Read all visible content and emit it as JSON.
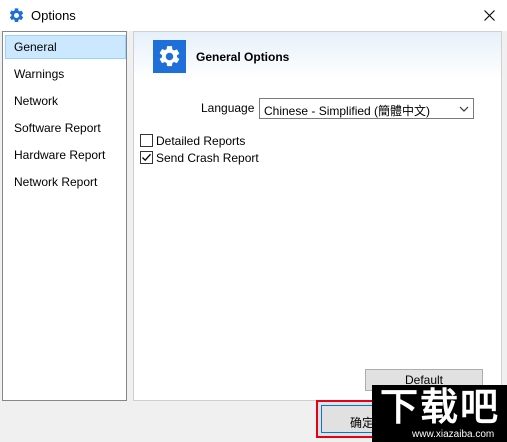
{
  "window": {
    "title": "Options",
    "icon": "gear-icon"
  },
  "sidebar": {
    "items": [
      {
        "label": "General",
        "selected": true
      },
      {
        "label": "Warnings",
        "selected": false
      },
      {
        "label": "Network",
        "selected": false
      },
      {
        "label": "Software Report",
        "selected": false
      },
      {
        "label": "Hardware Report",
        "selected": false
      },
      {
        "label": "Network Report",
        "selected": false
      }
    ]
  },
  "general": {
    "header_title": "General Options",
    "header_icon": "gear-icon",
    "language_label": "Language",
    "language_value": "Chinese - Simplified (簡體中文)",
    "checkboxes": [
      {
        "label": "Detailed Reports",
        "checked": false
      },
      {
        "label": "Send Crash Report",
        "checked": true
      }
    ],
    "default_button": "Default"
  },
  "footer": {
    "ok_button": "确定"
  },
  "watermark": {
    "text": "下载吧",
    "url_text": "www.xiazaiba.com"
  },
  "colors": {
    "accent": "#1e6fd9",
    "selection": "#cce8ff",
    "highlight_border": "#e60012"
  }
}
